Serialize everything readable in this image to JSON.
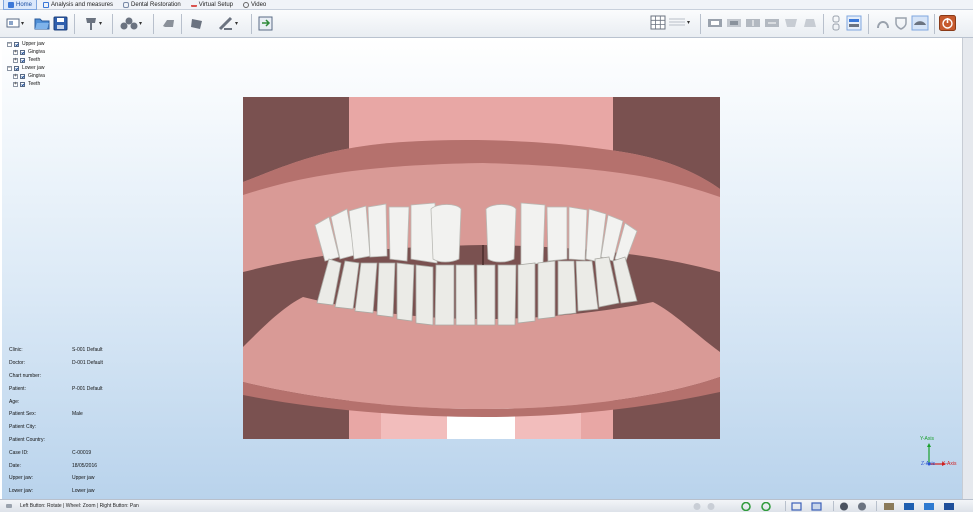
{
  "tabs": [
    {
      "label": "Home",
      "active": true,
      "icon": "home-icon",
      "color": "#3b78d8"
    },
    {
      "label": "Analysis and measures",
      "active": false,
      "icon": "analysis-icon",
      "color": "#3b78d8"
    },
    {
      "label": "Dental Restoration",
      "active": false,
      "icon": "tooth-icon",
      "color": "#7a8ba8"
    },
    {
      "label": "Virtual Setup",
      "active": false,
      "icon": "setup-icon",
      "color": "#d9534f"
    },
    {
      "label": "Video",
      "active": false,
      "icon": "video-icon",
      "color": "#666666"
    }
  ],
  "tree": [
    {
      "label": "Upper jaw",
      "level": 0,
      "expander": "−"
    },
    {
      "label": "Gingiva",
      "level": 1,
      "expander": "+"
    },
    {
      "label": "Teeth",
      "level": 1,
      "expander": "+"
    },
    {
      "label": "Lower jaw",
      "level": 0,
      "expander": "−"
    },
    {
      "label": "Gingiva",
      "level": 1,
      "expander": "+"
    },
    {
      "label": "Teeth",
      "level": 1,
      "expander": "+"
    }
  ],
  "patient_info": [
    {
      "label": "Clinic:",
      "value": "S-001 Default"
    },
    {
      "label": "Doctor:",
      "value": "D-001 Default"
    },
    {
      "label": "Chart number:",
      "value": ""
    },
    {
      "label": "Patient:",
      "value": "P-001 Default"
    },
    {
      "label": " Age:",
      "value": ""
    },
    {
      "label": "Patient Sex:",
      "value": "Male"
    },
    {
      "label": "Patient City:",
      "value": ""
    },
    {
      "label": "Patient Country:",
      "value": ""
    },
    {
      "label": "Case  ID:",
      "value": "C-00019"
    },
    {
      "label": "Date:",
      "value": "18/05/2016"
    },
    {
      "label": "Upper jaw:",
      "value": "Upper jaw"
    },
    {
      "label": "Lower jaw:",
      "value": "Lower jaw"
    }
  ],
  "axes": {
    "y": "Y-Axis",
    "z": "Z-Axis",
    "x": "X-Axis",
    "y_color": "#1aa02c",
    "x_color": "#d11f1f"
  },
  "status": {
    "text": "Left Button: Rotate | Wheel: Zoom | Right Button: Pan"
  },
  "colors": {
    "gum": "#d99a96",
    "gum_dark": "#b5716d",
    "tooth": "#f2f2f0",
    "base_side": "#7a5150",
    "base_front": "#e8a7a5"
  }
}
